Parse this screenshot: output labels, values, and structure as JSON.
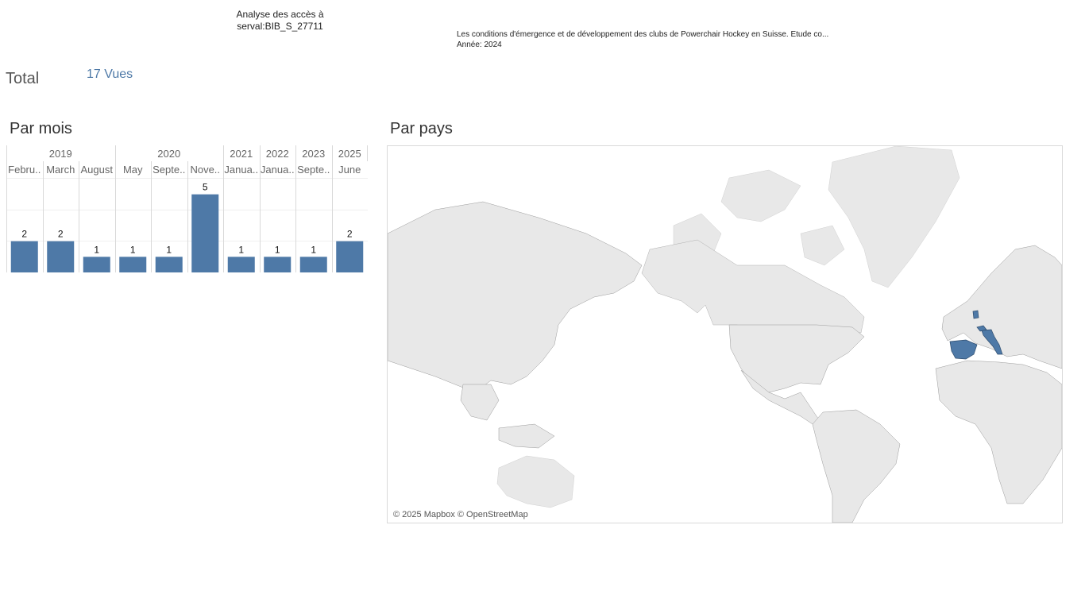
{
  "header": {
    "title_line1": "Analyse des accès à",
    "title_line2": "serval:BIB_S_27711",
    "doc_title": "Les conditions d'émergence et de développement des clubs de Powerchair Hockey en Suisse. Etude co...",
    "doc_year": "Année: 2024"
  },
  "total": {
    "label": "Total",
    "value": "17 Vues"
  },
  "sections": {
    "by_month": "Par mois",
    "by_country": "Par pays"
  },
  "map": {
    "credit": "© 2025 Mapbox © OpenStreetMap",
    "highlighted_countries": [
      "Spain",
      "Italy",
      "Switzerland",
      "Netherlands"
    ],
    "colors": {
      "highlight": "#4e79a7",
      "land": "#e8e8e8",
      "border": "#9a9a9a"
    }
  },
  "chart_data": {
    "type": "bar",
    "year_groups": [
      {
        "year": "2019",
        "count": 3
      },
      {
        "year": "2020",
        "count": 3
      },
      {
        "year": "2021",
        "count": 1
      },
      {
        "year": "2022",
        "count": 1
      },
      {
        "year": "2023",
        "count": 1
      },
      {
        "year": "2025",
        "count": 1
      }
    ],
    "categories": [
      "Febru..",
      "March",
      "August",
      "May",
      "Septe..",
      "Nove..",
      "Janua..",
      "Janua..",
      "Septe..",
      "June"
    ],
    "values": [
      2,
      2,
      1,
      1,
      1,
      5,
      1,
      1,
      1,
      2
    ],
    "ylim": [
      0,
      6
    ],
    "bar_color": "#4e79a7",
    "grid": true
  }
}
